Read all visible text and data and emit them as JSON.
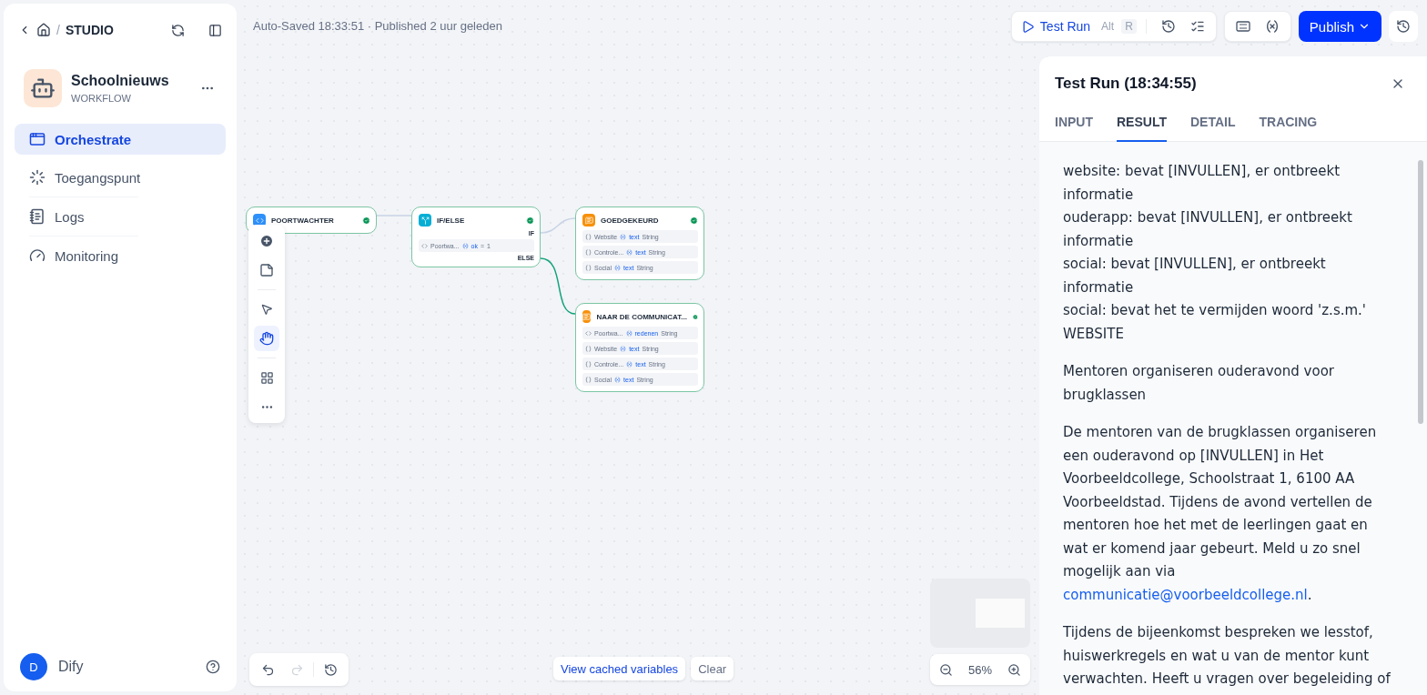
{
  "sidebar": {
    "breadcrumb_separator": "/",
    "breadcrumb": "STUDIO",
    "app": {
      "name": "Schoolnieuws",
      "type": "WORKFLOW"
    },
    "nav": [
      {
        "kind": "orchestrate",
        "label": "Orchestrate",
        "selected": true
      },
      {
        "kind": "access",
        "label": "Toegangspunt",
        "selected": false
      },
      {
        "kind": "logs",
        "label": "Logs",
        "selected": false
      },
      {
        "kind": "monitoring",
        "label": "Monitoring",
        "selected": false
      }
    ],
    "user": {
      "initial": "D",
      "name": "Dify"
    }
  },
  "status": "Auto-Saved 18:33:51 · Published 2 uur geleden",
  "toolbar": {
    "test_run": "Test Run",
    "shortcut": [
      "Alt",
      "R"
    ],
    "publish": "Publish"
  },
  "canvas": {
    "nodes": [
      {
        "kind": "code",
        "title": "POORTWACHTER"
      },
      {
        "kind": "ifelse",
        "title": "IF/ELSE",
        "if_label": "IF",
        "else_label": "ELSE",
        "condition": {
          "source": "Poortwa...",
          "variable": "ok",
          "operator": "=",
          "value": "1"
        }
      },
      {
        "kind": "answer",
        "title": "GOEDGEKEURD",
        "rows": [
          {
            "kind": "llm",
            "source": "Website",
            "variable": "text",
            "type": "String"
          },
          {
            "kind": "llm",
            "source": "Controle...",
            "variable": "text",
            "type": "String"
          },
          {
            "kind": "llm",
            "source": "Social",
            "variable": "text",
            "type": "String"
          }
        ]
      },
      {
        "kind": "answer",
        "title": "NAAR DE COMMUNICAT...",
        "rows": [
          {
            "kind": "code",
            "source": "Poortwa...",
            "variable": "redenen",
            "type": "String"
          },
          {
            "kind": "llm",
            "source": "Website",
            "variable": "text",
            "type": "String"
          },
          {
            "kind": "llm",
            "source": "Controle...",
            "variable": "text",
            "type": "String"
          },
          {
            "kind": "llm",
            "source": "Social",
            "variable": "text",
            "type": "String"
          }
        ]
      }
    ],
    "cached_variables": "View cached variables",
    "clear": "Clear",
    "zoom": "56%"
  },
  "panel": {
    "title": "Test Run (18:34:55)",
    "tabs": [
      {
        "label": "INPUT",
        "selected": false
      },
      {
        "label": "RESULT",
        "selected": true
      },
      {
        "label": "DETAIL",
        "selected": false
      },
      {
        "label": "TRACING",
        "selected": false
      }
    ],
    "result": [
      {
        "kind": "lines",
        "lines": [
          "website: bevat [INVULLEN], er ontbreekt informatie",
          "ouderapp: bevat [INVULLEN], er ontbreekt informatie",
          "social: bevat [INVULLEN], er ontbreekt informatie",
          "social: bevat het te vermijden woord 'z.s.m.'",
          "WEBSITE"
        ]
      },
      {
        "kind": "text",
        "text": "Mentoren organiseren ouderavond voor brugklassen"
      },
      {
        "kind": "link_text",
        "text": "De mentoren van de brugklassen organiseren een ouderavond op [INVULLEN] in Het Voorbeeldcollege, Schoolstraat 1, 6100 AA Voorbeeldstad. Tijdens de avond vertellen de mentoren hoe het met de leerlingen gaat en wat er komend jaar gebeurt. Meld u zo snel mogelijk aan via",
        "link": "communicatie@voorbeeldcollege.nl",
        "after": "."
      },
      {
        "kind": "text",
        "text": "Tijdens de bijeenkomst bespreken we lesstof, huiswerkregels en wat u van de mentor kunt verwachten. Heeft u vragen over begeleiding of"
      }
    ]
  }
}
